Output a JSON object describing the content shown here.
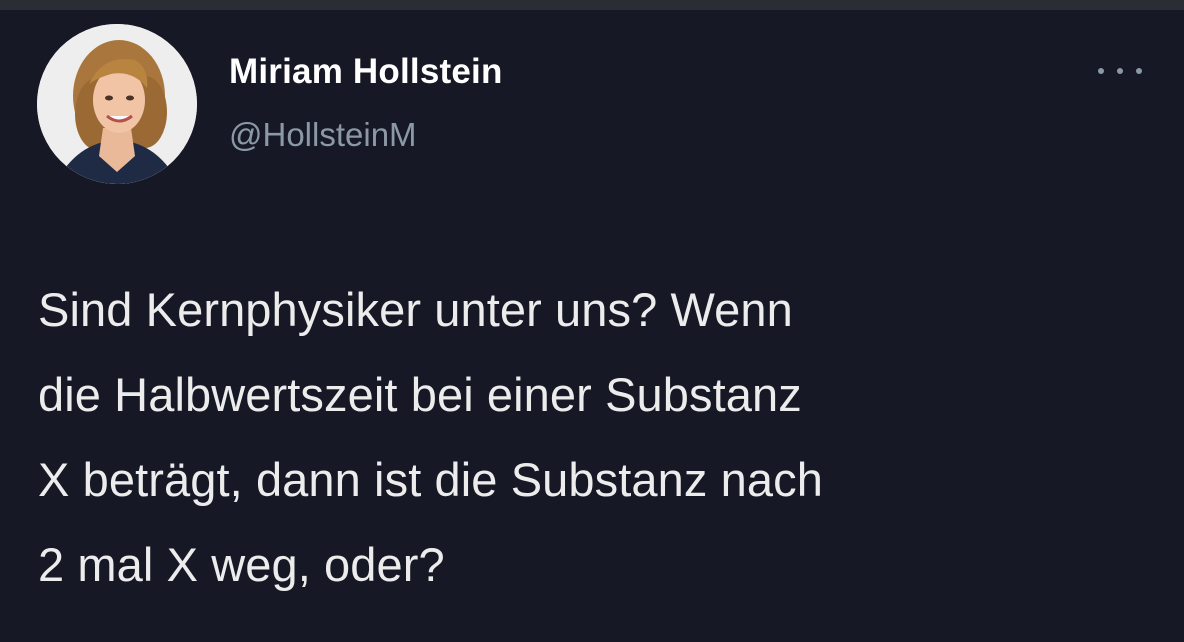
{
  "author": {
    "name": "Miriam Hollstein",
    "handle": "@HollsteinM",
    "avatar_icon": "profile-photo"
  },
  "menu": {
    "icon": "more-options-icon"
  },
  "tweet": {
    "lines": [
      "Sind Kernphysiker unter uns? Wenn",
      "die Halbwertszeit bei einer Substanz",
      "X beträgt, dann ist die Substanz nach",
      "2 mal X weg, oder?"
    ]
  },
  "colors": {
    "background": "#161925",
    "name": "#ffffff",
    "handle": "#8b98a5",
    "text": "#ececec"
  }
}
